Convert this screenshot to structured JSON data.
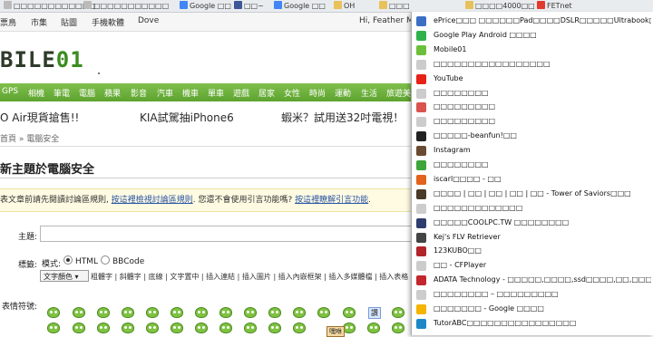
{
  "bookmarks": [
    {
      "label": "□□□□□□□□□□□□",
      "icon": "page-icon",
      "color": "#bbbbbb"
    },
    {
      "label": "□□□□□□□□□□□",
      "icon": "page-icon",
      "color": "#bbbbbb"
    },
    {
      "label": "Google □□",
      "icon": "google-icon",
      "color": "#4285f4"
    },
    {
      "label": "□□~",
      "icon": "facebook-icon",
      "color": "#3b5998"
    },
    {
      "label": "Google □□",
      "icon": "google-icon",
      "color": "#4285f4"
    },
    {
      "label": "OH",
      "icon": "folder-icon",
      "color": "#e8c15a"
    },
    {
      "label": "□□□",
      "icon": "folder-icon",
      "color": "#e8c15a"
    },
    {
      "label": "□□□□4000□□",
      "icon": "folder-icon",
      "color": "#e8c15a"
    },
    {
      "label": "FETnet",
      "icon": "flag-icon",
      "color": "#e23b2e"
    }
  ],
  "topnav": {
    "items": [
      "票鳥",
      "市集",
      "貼圖",
      "手機軟體",
      "Dove"
    ],
    "greeting": "Hi, Feather Mar"
  },
  "logo": {
    "text_a": "BILE",
    "text_b": "01"
  },
  "categories": [
    "GPS",
    "相機",
    "筆電",
    "電腦",
    "蘋果",
    "影音",
    "汽車",
    "機車",
    "單車",
    "遊戲",
    "居家",
    "女性",
    "時尚",
    "運動",
    "生活",
    "旅遊美"
  ],
  "promo": [
    "O Air現貨搶售!!",
    "KIA試駕抽iPhone6",
    "蝦米？試用送32吋電視！"
  ],
  "breadcrumb": "首頁 » 電腦安全",
  "page_title": "新主題於電腦安全",
  "notice": {
    "prefix": "表文章前請先閱讀討論區規則, ",
    "link1": "按這裡檢視討論區規則",
    "middle": ". 您還不會使用引言功能嗎? ",
    "link2": "按這裡瞭解引言功能",
    "suffix": "."
  },
  "form": {
    "subject_label": "主題:",
    "format_label": "標籤:",
    "mode_label": "模式:",
    "radio_html": "HTML",
    "radio_bbcode": "BBCode",
    "color_select": "文字顏色",
    "toolbar_items": "粗體字 | 斜體字 | 底線 | 文字置中 | 插入連結 | 插入圖片 | 插入內嵌框架 | 插入多媒體檔 | 插入表格 |",
    "emoticons_label": "表情符號:",
    "emoticon_tag_1": "讚",
    "emoticon_tag_2": "嘿咻"
  },
  "dropdown": [
    {
      "label": "ePrice□□□ □□□□□□Pad□□□□DSLR□□□□□Ultrabook□□□□□",
      "icon": "eprice-icon",
      "color": "#3c6fc4"
    },
    {
      "label": "Google Play Android □□□□",
      "icon": "google-play-icon",
      "color": "#2fb24c"
    },
    {
      "label": "Mobile01",
      "icon": "mobile01-icon",
      "color": "#6cbf3a"
    },
    {
      "label": "□□□□□□□□□□□□□□□□□",
      "icon": "page-icon",
      "color": "#cccccc"
    },
    {
      "label": "YouTube",
      "icon": "youtube-icon",
      "color": "#e62117"
    },
    {
      "label": "□□□□□□□□",
      "icon": "page-icon",
      "color": "#cccccc"
    },
    {
      "label": "□□□□□□□□□",
      "icon": "colorful-icon",
      "color": "#d9534f"
    },
    {
      "label": "□□□□□□□□□",
      "icon": "page-icon",
      "color": "#cccccc"
    },
    {
      "label": "□□□□□-beanfun!□□",
      "icon": "beanfun-icon",
      "color": "#222222"
    },
    {
      "label": "Instagram",
      "icon": "instagram-icon",
      "color": "#6b4a33"
    },
    {
      "label": "□□□□□□□□",
      "icon": "camera-icon",
      "color": "#3da53a"
    },
    {
      "label": "iscarl□□□□ - □□",
      "icon": "iscarl-icon",
      "color": "#e2621e"
    },
    {
      "label": "□□□□ | □□ | □□ | □□ | □□ - Tower of Saviors□□□",
      "icon": "tos-icon",
      "color": "#4a3a28"
    },
    {
      "label": "□□□□□□□□□□□□□",
      "icon": "page-icon",
      "color": "#cccccc"
    },
    {
      "label": "□□□□□COOLPC.TW □□□□□□□□",
      "icon": "coolpc-icon",
      "color": "#2f3d6e"
    },
    {
      "label": "Kej's FLV Retriever",
      "icon": "wikipedia-icon",
      "color": "#444444"
    },
    {
      "label": "123KUBO□□",
      "icon": "kubo-icon",
      "color": "#b0242a"
    },
    {
      "label": "□□ - CFPlayer",
      "icon": "page-icon",
      "color": "#cccccc"
    },
    {
      "label": "ADATA Technology - □□□□□,□□□□,ssd□□□□,□□,□□□□□□□,S...",
      "icon": "adata-icon",
      "color": "#c1272d"
    },
    {
      "label": "□□□□□□□□ – □□□□□□□□□",
      "icon": "page-icon",
      "color": "#cccccc"
    },
    {
      "label": "□□□□□□□ - Google □□□□",
      "icon": "google-drive-icon",
      "color": "#f4b400"
    },
    {
      "label": "TutorABC□□□□□□□□□□□□□□□□",
      "icon": "tutorabc-icon",
      "color": "#1e88c7"
    }
  ]
}
